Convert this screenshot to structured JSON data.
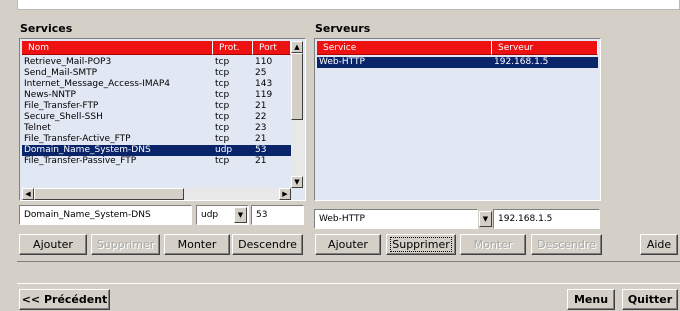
{
  "services": {
    "title": "Services",
    "columns": [
      "Nom",
      "Prot.",
      "Port"
    ],
    "rows": [
      {
        "name": "Retrieve_Mail-POP3",
        "prot": "tcp",
        "port": "110"
      },
      {
        "name": "Send_Mail-SMTP",
        "prot": "tcp",
        "port": "25"
      },
      {
        "name": "Internet_Message_Access-IMAP4",
        "prot": "tcp",
        "port": "143"
      },
      {
        "name": "News-NNTP",
        "prot": "tcp",
        "port": "119"
      },
      {
        "name": "File_Transfer-FTP",
        "prot": "tcp",
        "port": "21"
      },
      {
        "name": "Secure_Shell-SSH",
        "prot": "tcp",
        "port": "22"
      },
      {
        "name": "Telnet",
        "prot": "tcp",
        "port": "23"
      },
      {
        "name": "File_Transfer-Active_FTP",
        "prot": "tcp",
        "port": "21"
      },
      {
        "name": "Domain_Name_System-DNS",
        "prot": "udp",
        "port": "53",
        "selected": true
      },
      {
        "name": "File_Transfer-Passive_FTP",
        "prot": "tcp",
        "port": "21"
      }
    ],
    "edit": {
      "name": "Domain_Name_System-DNS",
      "prot": "udp",
      "port": "53"
    },
    "buttons": {
      "add": "Ajouter",
      "delete": "Supprimer",
      "up": "Monter",
      "down": "Descendre"
    }
  },
  "servers": {
    "title": "Serveurs",
    "columns": [
      "Service",
      "Serveur"
    ],
    "rows": [
      {
        "service": "Web-HTTP",
        "server": "192.168.1.5",
        "selected": true
      }
    ],
    "edit": {
      "service": "Web-HTTP",
      "server": "192.168.1.5"
    },
    "buttons": {
      "add": "Ajouter",
      "delete": "Supprimer",
      "up": "Monter",
      "down": "Descendre"
    }
  },
  "help_button": "Aide",
  "footer": {
    "previous": "<< Précédent",
    "menu": "Menu",
    "quit": "Quitter"
  },
  "icons": {
    "up_arrow": "▲",
    "down_arrow": "▼",
    "left_arrow": "◀",
    "right_arrow": "▶"
  },
  "colors": {
    "header": "#ee1111",
    "selection": "#0a246a",
    "list_bg": "#e1e8f4"
  }
}
